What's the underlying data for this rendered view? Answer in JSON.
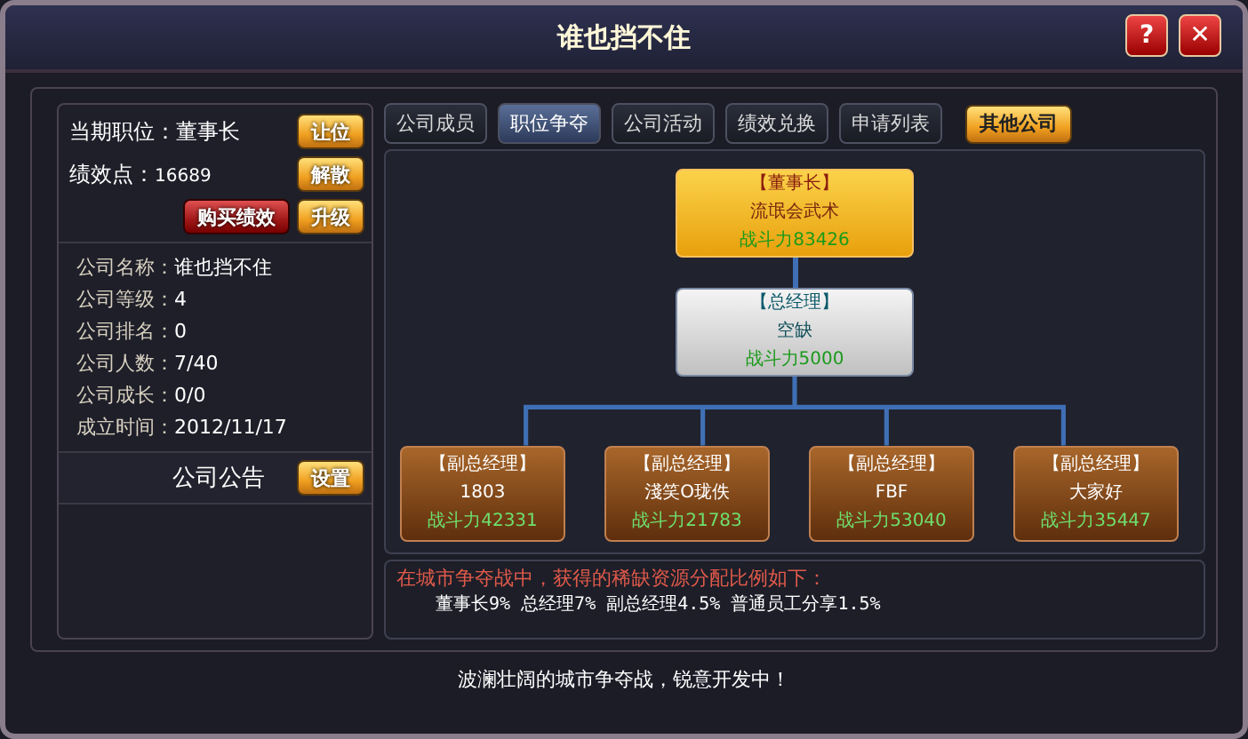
{
  "window": {
    "title": "谁也挡不住",
    "help": "?",
    "close": "✕"
  },
  "profile": {
    "position_label": "当期职位：",
    "position": "董事长",
    "points_label": "绩效点：",
    "points": "16689",
    "buttons": [
      {
        "label": "让位",
        "kind": "gold"
      },
      {
        "label": "解散",
        "kind": "gold"
      },
      {
        "label": "购买绩效",
        "kind": "red"
      },
      {
        "label": "升级",
        "kind": "gold"
      }
    ]
  },
  "info": [
    {
      "label": "公司名称：",
      "value": "谁也挡不住"
    },
    {
      "label": "公司等级：",
      "value": "4"
    },
    {
      "label": "公司排名：",
      "value": "0"
    },
    {
      "label": "公司人数：",
      "value": "7/40"
    },
    {
      "label": "公司成长：",
      "value": "0/0"
    },
    {
      "label": "成立时间：",
      "value": "2012/11/17"
    }
  ],
  "notice": {
    "title": "公司公告",
    "button": "设置"
  },
  "tabs": [
    {
      "label": "公司成员",
      "selected": false
    },
    {
      "label": "职位争夺",
      "selected": true
    },
    {
      "label": "公司活动",
      "selected": false
    },
    {
      "label": "绩效兑换",
      "selected": false
    },
    {
      "label": "申请列表",
      "selected": false
    }
  ],
  "other_button": "其他公司",
  "org": [
    {
      "kind": "chairman",
      "role": "【董事长】",
      "name": "流氓会武术",
      "power": "战斗力83426"
    },
    {
      "kind": "gm",
      "role": "【总经理】",
      "name": "空缺",
      "power": "战斗力5000"
    },
    {
      "kind": "vice",
      "role": "【副总经理】",
      "name": "1803",
      "power": "战斗力42331"
    },
    {
      "kind": "vice",
      "role": "【副总经理】",
      "name": "淺笑O珑佚",
      "power": "战斗力21783"
    },
    {
      "kind": "vice",
      "role": "【副总经理】",
      "name": "FBF",
      "power": "战斗力53040"
    },
    {
      "kind": "vice",
      "role": "【副总经理】",
      "name": "大家好",
      "power": "战斗力35447"
    }
  ],
  "rules": {
    "heading": "在城市争夺战中，获得的稀缺资源分配比例如下：",
    "detail": "董事长9% 总经理7% 副总经理4.5% 普通员工分享1.5%"
  },
  "footer": "波澜壮阔的城市争夺战，锐意开发中！"
}
